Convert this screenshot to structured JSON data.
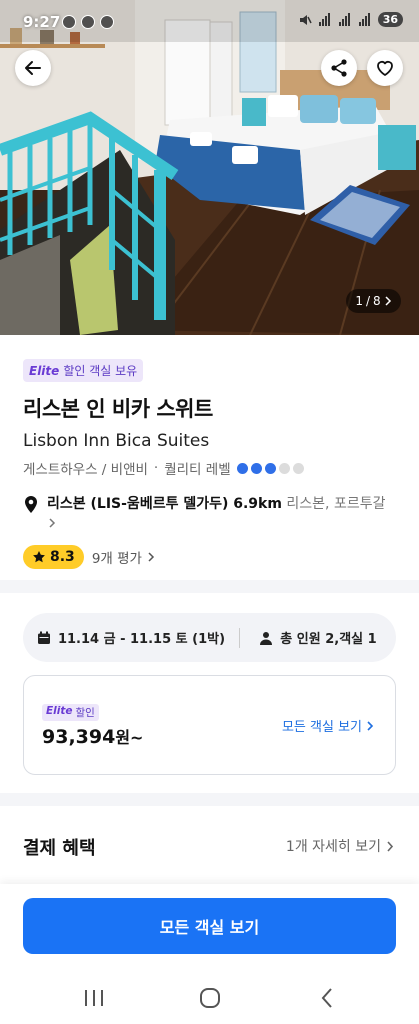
{
  "status_bar": {
    "time": "9:27",
    "battery": "36"
  },
  "hero": {
    "photo_counter_current": "1",
    "photo_counter_sep": "/",
    "photo_counter_total": "8",
    "icons": {
      "back": "arrow-left-icon",
      "share": "share-icon",
      "wishlist": "heart-icon"
    }
  },
  "property": {
    "elite_badge": {
      "brand": "Elite",
      "text": "할인 객실 보유"
    },
    "name_ko": "리스본 인 비카 스위트",
    "name_en": "Lisbon Inn Bica Suites",
    "category": "게스트하우스 / 비앤비",
    "separator": "·",
    "quality_label": "퀄리티 레벨",
    "quality_level": 3,
    "quality_max": 5,
    "location_main": "리스본 (LIS-움베르투 델가두) 6.9km",
    "location_sub": "리스본, 포르투갈",
    "rating": "8.3",
    "review_count": "9개 평가"
  },
  "booking": {
    "dates": "11.14 금 - 11.15 토 (1박)",
    "guests": "총 인원 2,객실 1",
    "price_tag": {
      "brand": "Elite",
      "text": "할인"
    },
    "price_value": "93,394",
    "price_suffix": "원~",
    "view_rooms_link": "모든 객실 보기"
  },
  "benefits": {
    "title": "결제 혜택",
    "more": "1개 자세히 보기"
  },
  "cta": {
    "label": "모든 객실 보기"
  },
  "colors": {
    "accent": "#1a73f5",
    "elite": "#6a3bd4",
    "rating": "#ffcc28",
    "quality_dot": "#2f6fe8"
  }
}
